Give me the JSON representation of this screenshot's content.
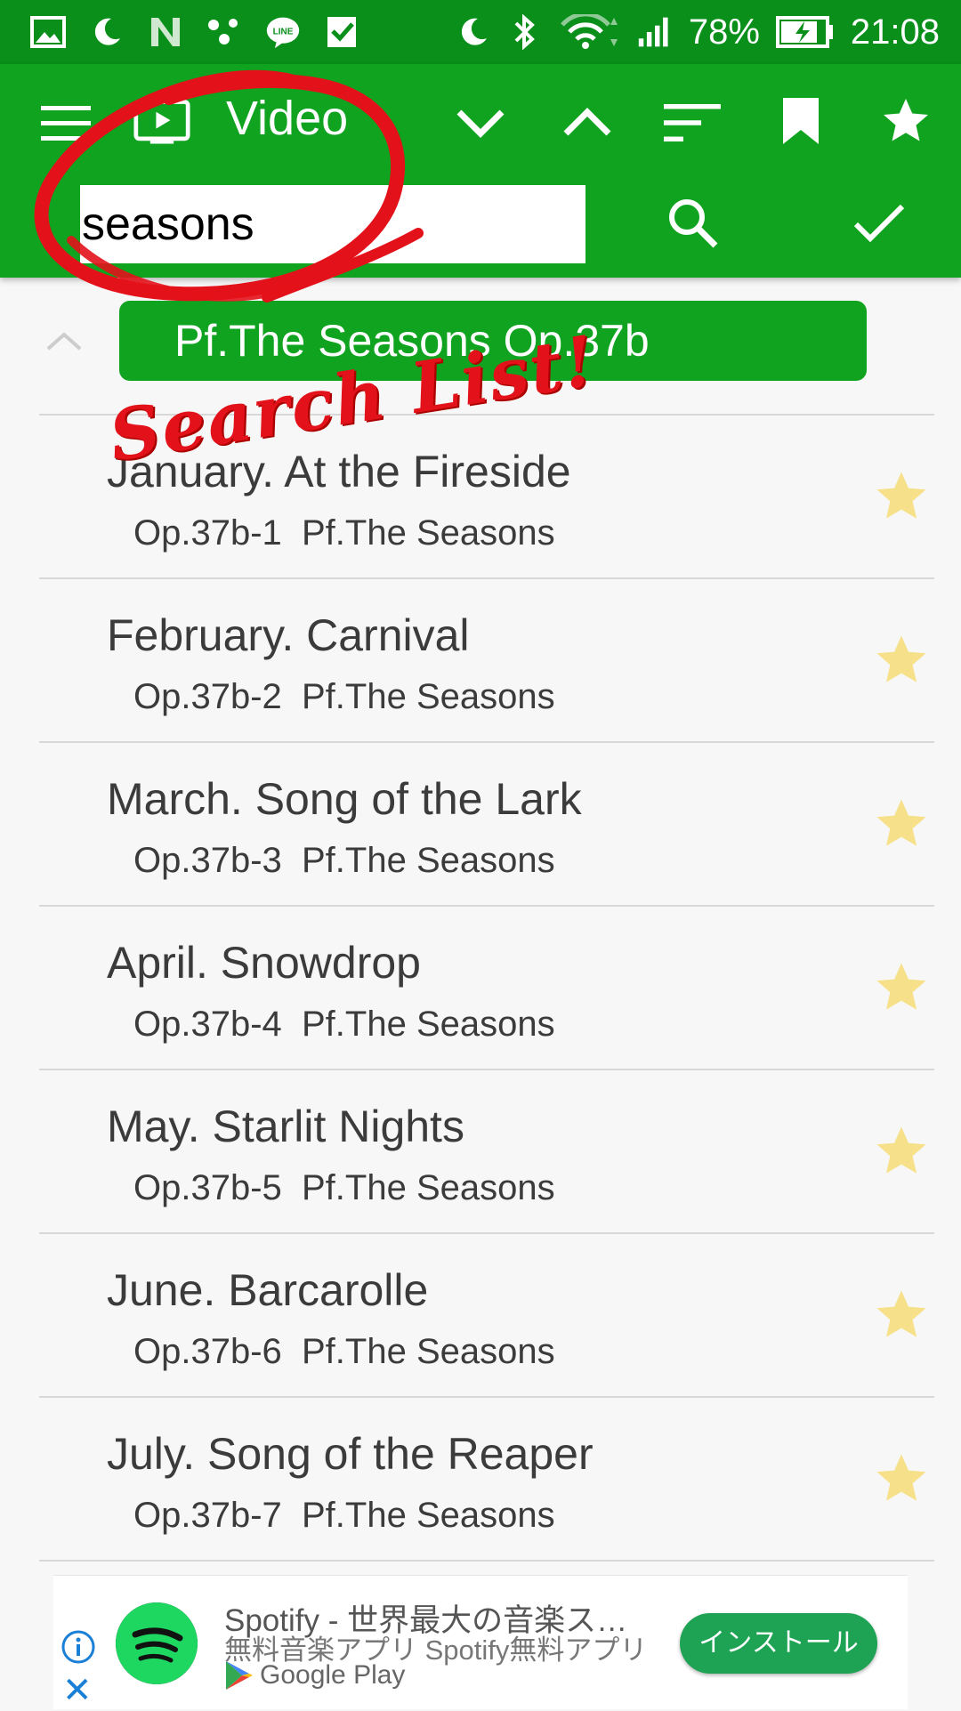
{
  "status_bar": {
    "battery": "78%",
    "time": "21:08",
    "icons": [
      "image-icon",
      "moon-icon",
      "n-icon",
      "dots-icon",
      "line-icon",
      "check-icon",
      "moon-icon",
      "bluetooth-icon",
      "wifi-icon",
      "signal-icon",
      "battery-icon"
    ]
  },
  "toolbar": {
    "title": "Video",
    "search_value": "seasons",
    "icons": [
      "menu-icon",
      "video-icon",
      "chevron-down-icon",
      "chevron-up-icon",
      "sort-icon",
      "bookmark-icon",
      "star-icon",
      "search-icon",
      "check-icon"
    ]
  },
  "list": {
    "group_label": "Pf.The Seasons Op.37b",
    "items": [
      {
        "title": "January. At the Fireside",
        "sub": "Op.37b-1  Pf.The Seasons"
      },
      {
        "title": "February. Carnival",
        "sub": "Op.37b-2  Pf.The Seasons"
      },
      {
        "title": "March. Song of the Lark",
        "sub": "Op.37b-3  Pf.The Seasons"
      },
      {
        "title": "April. Snowdrop",
        "sub": "Op.37b-4  Pf.The Seasons"
      },
      {
        "title": "May. Starlit Nights",
        "sub": "Op.37b-5  Pf.The Seasons"
      },
      {
        "title": "June. Barcarolle",
        "sub": "Op.37b-6  Pf.The Seasons"
      },
      {
        "title": "July. Song of the Reaper",
        "sub": "Op.37b-7  Pf.The Seasons"
      }
    ]
  },
  "ad": {
    "line1": "Spotify - 世界最大の音楽ス…",
    "line2": "無料音楽アプリ Spotify無料アプリ",
    "store": "Google Play",
    "install_label": "インストール"
  },
  "annotation": {
    "text": "Search List!"
  },
  "colors": {
    "status_bar": "#098f1a",
    "toolbar": "#0fa31f",
    "star": "#f7e08a",
    "annotation": "#e3121a",
    "install": "#1ea354"
  }
}
